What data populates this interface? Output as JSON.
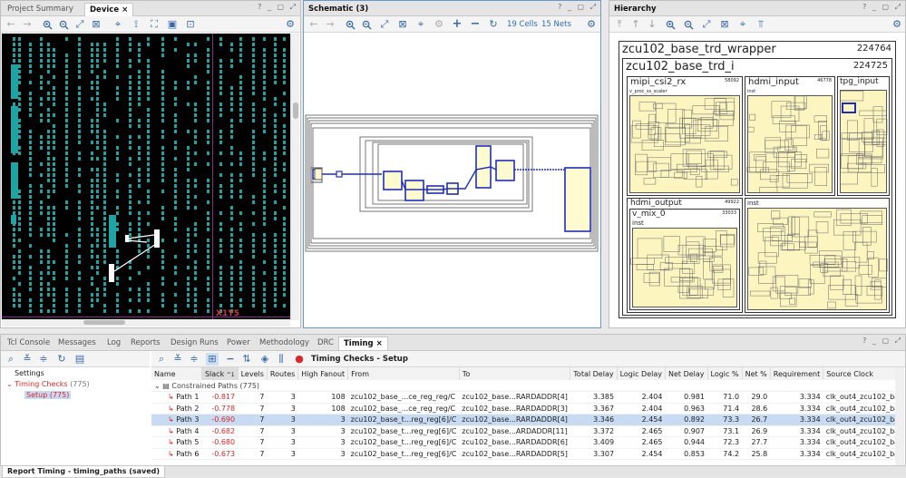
{
  "device_panel": {
    "tabs": [
      "Project Summary",
      "Device"
    ],
    "tab_close": "×",
    "overlay_label": "X1Y5"
  },
  "schematic_panel": {
    "title": "Schematic (3)",
    "cells": "19 Cells",
    "nets": "15 Nets"
  },
  "hierarchy_panel": {
    "title": "Hierarchy",
    "top_name": "zcu102_base_trd_wrapper",
    "top_count": "224764",
    "inst_name": "zcu102_base_trd_i",
    "inst_count": "224725",
    "blocks": [
      {
        "name": "mipi_csi2_rx",
        "count": "58092"
      },
      {
        "name": "hdmi_input",
        "count": "46778"
      },
      {
        "name": "tpg_input",
        "count": ""
      },
      {
        "name": "hdmi_output",
        "count": "49922"
      },
      {
        "name": "v_mix_0",
        "count": "33033"
      }
    ],
    "sub_labels": {
      "proc_ss_scaler": "v_proc_ss_scaler",
      "inst": "inst",
      "vmix_inst": "inst",
      "hdmi_inst": "inst"
    }
  },
  "bottom_tabs": [
    "Tcl Console",
    "Messages",
    "Log",
    "Reports",
    "Design Runs",
    "Power",
    "Methodology",
    "DRC",
    "Timing"
  ],
  "timing": {
    "tree": {
      "settings": "Settings",
      "timing_checks": "Timing Checks",
      "timing_checks_count": "(775)",
      "setup": "Setup (775)"
    },
    "title": "Timing Checks - Setup",
    "columns": [
      "Name",
      "Slack",
      "Levels",
      "Routes",
      "High Fanout",
      "From",
      "To",
      "Total Delay",
      "Logic Delay",
      "Net Delay",
      "Logic %",
      "Net %",
      "Requirement",
      "Source Clock"
    ],
    "group_label": "Constrained Paths",
    "group_count": "(775)",
    "rows": [
      {
        "name": "Path 1",
        "slack": "-0.817",
        "levels": "7",
        "routes": "3",
        "fanout": "108",
        "from": "zcu102_base_...ce_reg_reg/C",
        "to": "zcu102_base...RARDADDR[4]",
        "total": "3.385",
        "logic": "2.404",
        "net": "0.981",
        "logicp": "71.0",
        "netp": "29.0",
        "req": "3.334",
        "clock": "clk_out4_zcu102_base_trd_clk_"
      },
      {
        "name": "Path 2",
        "slack": "-0.778",
        "levels": "7",
        "routes": "3",
        "fanout": "108",
        "from": "zcu102_base_...ce_reg_reg/C",
        "to": "zcu102_base...RARDADDR[3]",
        "total": "3.367",
        "logic": "2.404",
        "net": "0.963",
        "logicp": "71.4",
        "netp": "28.6",
        "req": "3.334",
        "clock": "clk_out4_zcu102_base_trd_clk_"
      },
      {
        "name": "Path 3",
        "slack": "-0.690",
        "levels": "7",
        "routes": "3",
        "fanout": "3",
        "from": "zcu102_base_t...reg_reg[6]/C",
        "to": "zcu102_base...RARDADDR[4]",
        "total": "3.346",
        "logic": "2.454",
        "net": "0.892",
        "logicp": "73.3",
        "netp": "26.7",
        "req": "3.334",
        "clock": "clk_out4_zcu102_base_trd_clk_"
      },
      {
        "name": "Path 4",
        "slack": "-0.682",
        "levels": "7",
        "routes": "3",
        "fanout": "3",
        "from": "zcu102_base_t...reg_reg[6]/C",
        "to": "zcu102_base...ARDADDR[11]",
        "total": "3.372",
        "logic": "2.465",
        "net": "0.907",
        "logicp": "73.1",
        "netp": "26.9",
        "req": "3.334",
        "clock": "clk_out4_zcu102_base_trd_clk_"
      },
      {
        "name": "Path 5",
        "slack": "-0.680",
        "levels": "7",
        "routes": "3",
        "fanout": "3",
        "from": "zcu102_base_t...reg_reg[6]/C",
        "to": "zcu102_base...RARDADDR[6]",
        "total": "3.409",
        "logic": "2.465",
        "net": "0.944",
        "logicp": "72.3",
        "netp": "27.7",
        "req": "3.334",
        "clock": "clk_out4_zcu102_base_trd_clk_"
      },
      {
        "name": "Path 6",
        "slack": "-0.673",
        "levels": "7",
        "routes": "3",
        "fanout": "3",
        "from": "zcu102_base_t...reg_reg[6]/C",
        "to": "zcu102_base...RARDADDR[5]",
        "total": "3.307",
        "logic": "2.454",
        "net": "0.853",
        "logicp": "74.2",
        "netp": "25.8",
        "req": "3.334",
        "clock": "clk_out4_zcu102_base_trd_clk_"
      }
    ],
    "selected_row": 2,
    "sort_indicator": "^1"
  },
  "status_bar": {
    "report_label": "Report Timing - timing_paths (saved)"
  },
  "colors": {
    "accent": "#2f6db5",
    "selection": "#c9dbf3",
    "negative": "#d62a2a",
    "device_cells": "#1fa3a3",
    "hier_fill": "#fdf5c0"
  }
}
